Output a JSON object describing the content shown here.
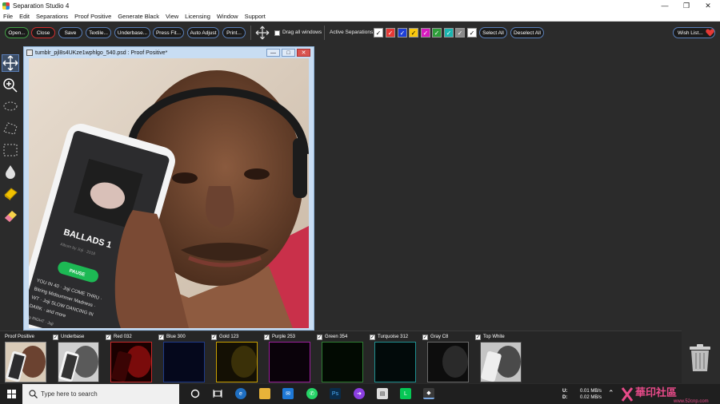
{
  "window": {
    "title": "Separation Studio 4"
  },
  "menu": [
    "File",
    "Edit",
    "Separations",
    "Proof Positive",
    "Generate Black",
    "View",
    "Licensing",
    "Window",
    "Support"
  ],
  "toolbar": {
    "open": "Open...",
    "close": "Close",
    "save": "Save",
    "textile": "Textile...",
    "underbase": "Underbase...",
    "press_fit": "Press Fit...",
    "auto_adjust": "Auto Adjust",
    "print": "Print...",
    "drag_all": "Drag all windows",
    "active_separations": "Active Separations:",
    "select_all": "Select All",
    "deselect_all": "Deselect All",
    "wish_list": "Wish List..."
  },
  "separation_swatches": [
    {
      "color": "#ffffff"
    },
    {
      "color": "#e53935"
    },
    {
      "color": "#1e3fd6"
    },
    {
      "color": "#f9c80e"
    },
    {
      "color": "#d81bbf"
    },
    {
      "color": "#2e9e3a"
    },
    {
      "color": "#1bb5b0"
    },
    {
      "color": "#8a8a8a"
    },
    {
      "color": "#ffffff"
    }
  ],
  "image_window": {
    "title": "tumblr_pjl8s4UKze1wphlgo_540.psd : Proof Positive*"
  },
  "phone_screen": {
    "title": "BALLADS 1",
    "artist": "Album by Joji · 2018",
    "button": "PAUSE",
    "lines": [
      "YOU IN 40 · Joji COME THRU ·",
      "Bitring Midsummer Madness ·",
      "WT · Joji SLOW DANCING IN",
      "DARK · and more"
    ],
    "footer": "Up RIGHT · Joji"
  },
  "channels": [
    {
      "label": "Proof Positive",
      "checkbox": false,
      "border": "#4a4a4a",
      "tint": "none"
    },
    {
      "label": "Underbase",
      "checkbox": true,
      "border": "#4a4a4a",
      "tint": "gray"
    },
    {
      "label": "Red 032",
      "checkbox": true,
      "border": "#c62828",
      "tint": "#7a0b0b"
    },
    {
      "label": "Blue 300",
      "checkbox": true,
      "border": "#1e3a8a",
      "tint": "#05081c"
    },
    {
      "label": "Gold 123",
      "checkbox": true,
      "border": "#c9a000",
      "tint": "#3a3008"
    },
    {
      "label": "Purple 253",
      "checkbox": true,
      "border": "#9c1f9c",
      "tint": "#120412"
    },
    {
      "label": "Green 354",
      "checkbox": true,
      "border": "#2e7d32",
      "tint": "#041204"
    },
    {
      "label": "Turquoise 312",
      "checkbox": true,
      "border": "#1e8f8f",
      "tint": "#041212"
    },
    {
      "label": "Gray C8",
      "checkbox": true,
      "border": "#6a6a6a",
      "tint": "#202020"
    },
    {
      "label": "Top White",
      "checkbox": true,
      "border": "#4a4a4a",
      "tint": "gray"
    }
  ],
  "taskbar": {
    "search_placeholder": "Type here to search",
    "upload_label": "U:",
    "upload_value": "0.01 MB/s",
    "download_label": "D:",
    "download_value": "0.02 MB/s"
  },
  "watermark": {
    "text": "華印社區",
    "url": "www.52cnp.com"
  }
}
